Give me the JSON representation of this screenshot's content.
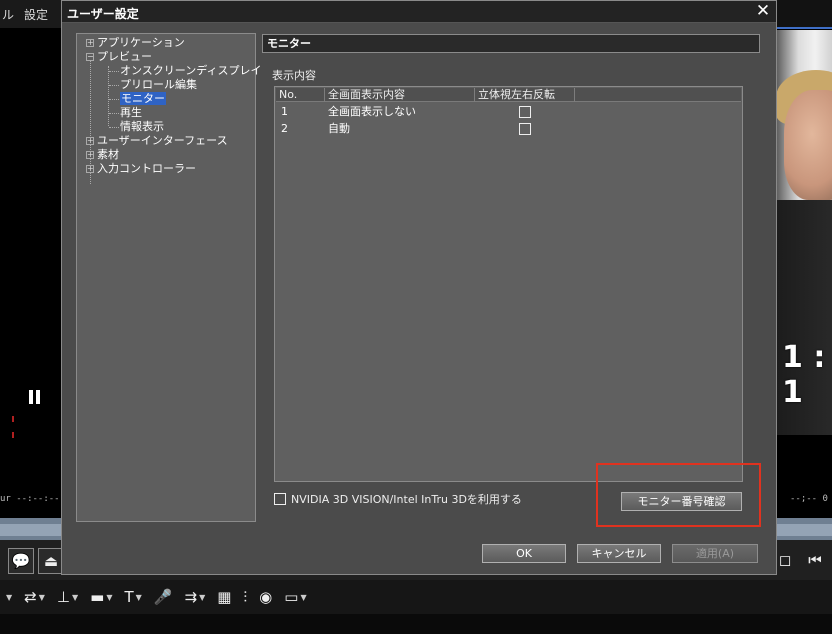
{
  "app": {
    "menu": [
      "ル",
      "設定"
    ],
    "left_timecode": "ur --:--:--",
    "right_timecode": "--;--   0",
    "clock_text": "1 : 1",
    "transport_buttons": [
      "◻",
      "⏮"
    ]
  },
  "toolbar": {
    "items": [
      "⇄",
      "⊥",
      "▬",
      "T",
      "🎤",
      "⇉",
      "▦",
      "⫶",
      "◉",
      "▭"
    ]
  },
  "dialog": {
    "title": "ユーザー設定",
    "close_label": "✕",
    "tree": [
      {
        "label": "アプリケーション",
        "expander": "+"
      },
      {
        "label": "プレビュー",
        "expander": "−"
      },
      {
        "label": "オンスクリーンディスプレイ"
      },
      {
        "label": "プリロール編集"
      },
      {
        "label": "モニター",
        "selected": true
      },
      {
        "label": "再生"
      },
      {
        "label": "情報表示"
      },
      {
        "label": "ユーザーインターフェース",
        "expander": "+"
      },
      {
        "label": "素材",
        "expander": "+"
      },
      {
        "label": "入力コントローラー",
        "expander": "+"
      }
    ],
    "section_title": "モニター",
    "display_label": "表示内容",
    "columns": [
      "No.",
      "全画面表示内容",
      "立体視左右反転"
    ],
    "rows": [
      {
        "no": "1",
        "content": "全画面表示しない",
        "flip": false
      },
      {
        "no": "2",
        "content": "自動",
        "flip": false
      }
    ],
    "nvidia_label": "NVIDIA 3D VISION/Intel InTru 3Dを利用する",
    "monitor_check_button": "モニター番号確認",
    "ok_button": "OK",
    "cancel_button": "キャンセル",
    "apply_button": "適用(A)",
    "highlight_color": "#e0321f"
  }
}
